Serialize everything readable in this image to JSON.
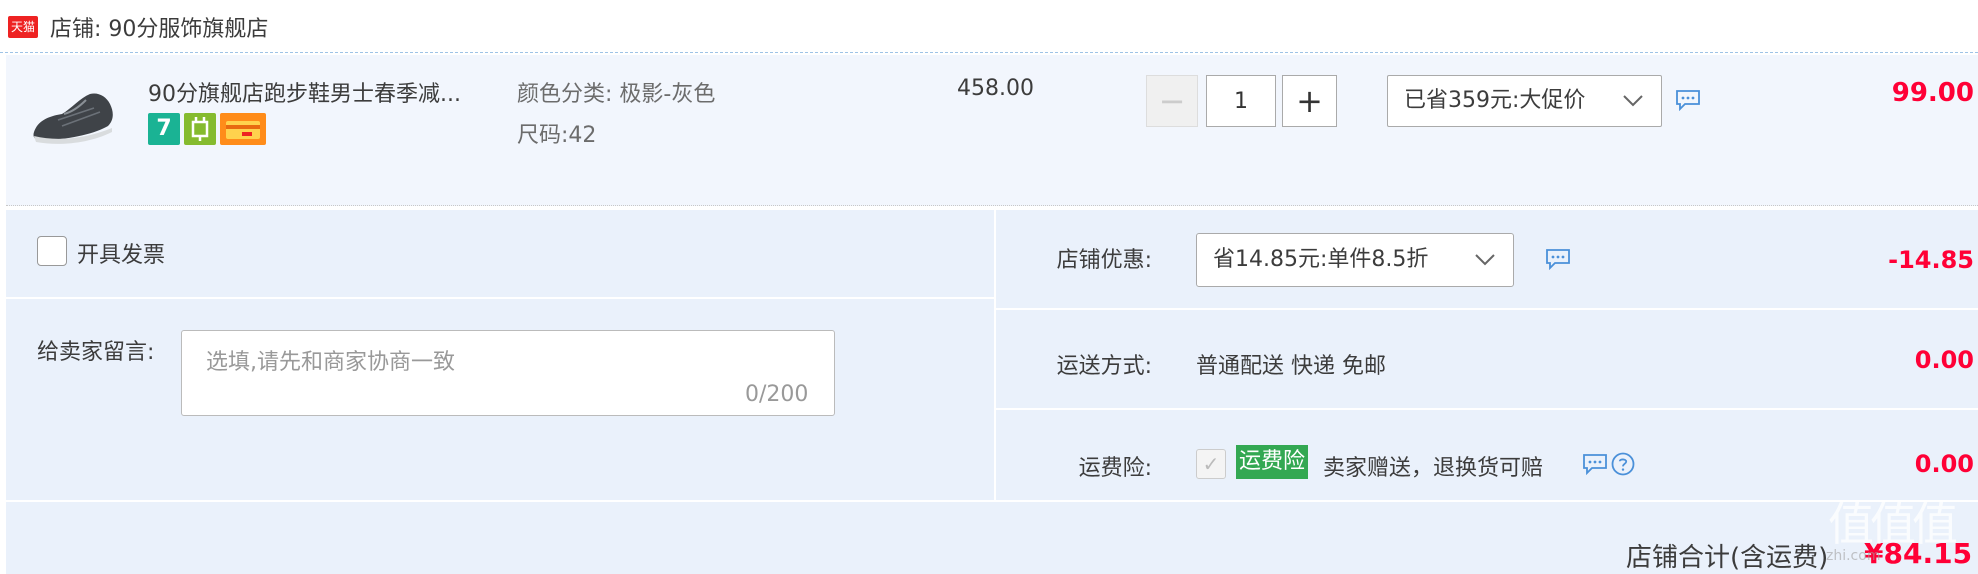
{
  "shop": {
    "logo_text": "天猫",
    "name": "店铺: 90分服饰旗舰店"
  },
  "item": {
    "title": "90分旗舰店跑步鞋男士春季减...",
    "color_label": "颜色分类:",
    "color_value": "极影-灰色",
    "size_label": "尺码:",
    "size_value": "42",
    "badge_1": "7",
    "original_price": "458.00",
    "quantity": "1",
    "minus_symbol": "−",
    "plus_symbol": "+",
    "promo_selected": "已省359元:大促价",
    "final_price": "99.00"
  },
  "invoice": {
    "label": "开具发票"
  },
  "message": {
    "label": "给卖家留言:",
    "placeholder": "选填,请先和商家协商一致",
    "counter": "0/200"
  },
  "shop_discount": {
    "label": "店铺优惠:",
    "selected": "省14.85元:单件8.5折",
    "amount": "-14.85"
  },
  "shipping": {
    "label": "运送方式:",
    "value": "普通配送 快递 免邮",
    "amount": "0.00"
  },
  "insurance": {
    "label": "运费险:",
    "badge": "运费险",
    "description": "卖家赠送，退换货可赔",
    "amount": "0.00"
  },
  "total": {
    "label": "店铺合计(含运费)",
    "amount": "¥84.15"
  },
  "watermark": {
    "glyphs": "值值值",
    "url": "zhi.com"
  },
  "colors": {
    "accent_red": "#ff0036",
    "panel_bg": "#eaf1fb",
    "insurance_green": "#33a852"
  },
  "icons": [
    "tmall-logo",
    "chat-icon",
    "chevron-down-icon",
    "check-icon",
    "help-icon"
  ]
}
